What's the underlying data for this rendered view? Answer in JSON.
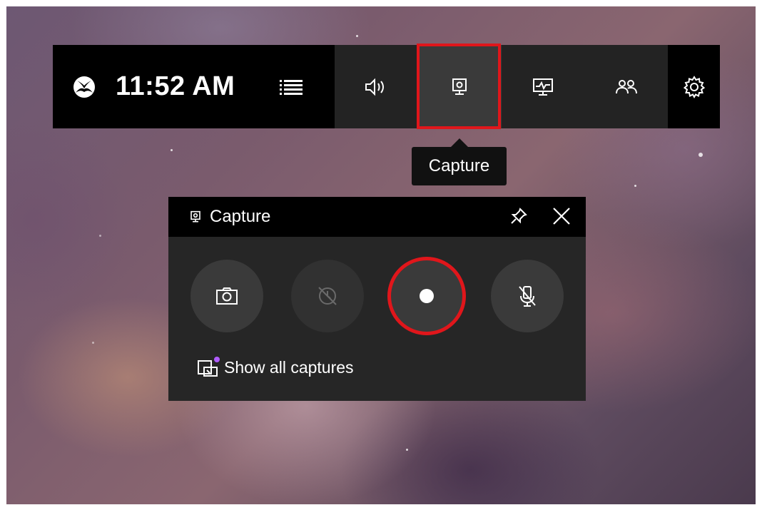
{
  "gamebar": {
    "time": "11:52 AM",
    "icons": {
      "xbox": "xbox-logo-icon",
      "menu": "widget-menu-icon",
      "audio": "speaker-icon",
      "capture": "capture-icon",
      "performance": "performance-monitor-icon",
      "social": "people-icon",
      "settings": "gear-icon"
    },
    "active_widget": "capture"
  },
  "tooltip": {
    "label": "Capture"
  },
  "capture_panel": {
    "title": "Capture",
    "buttons": [
      "screenshot-camera-icon",
      "record-last-30s-icon",
      "record-button",
      "microphone-muted-icon"
    ],
    "show_all_label": "Show all captures"
  },
  "colors": {
    "highlight": "#e0161b",
    "panel_bg": "#262626",
    "bar_bg": "#000000",
    "notification_dot": "#b05cff"
  }
}
